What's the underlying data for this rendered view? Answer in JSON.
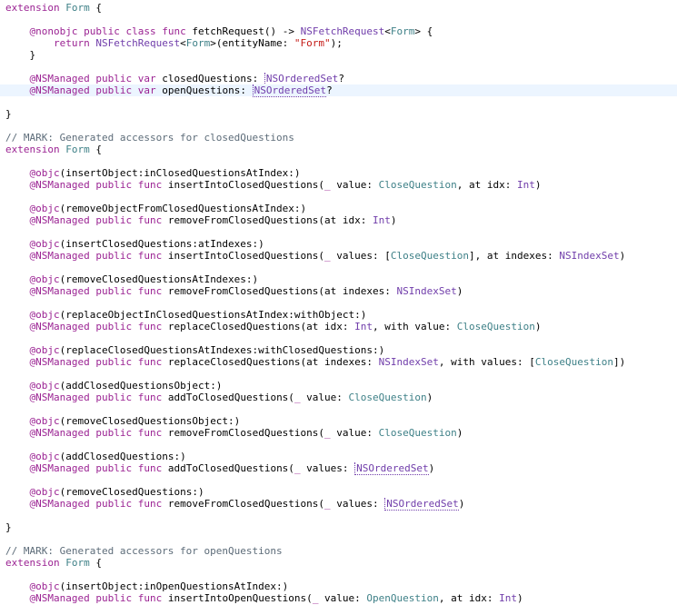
{
  "editor": {
    "colors": {
      "keyword": "#9b2393",
      "type": "#703daa",
      "project_type": "#3e8087",
      "string": "#c41a16",
      "comment": "#5d6c79",
      "current_line": "#ecf5ff"
    },
    "lines": [
      {
        "row": 0,
        "tokens": [
          {
            "t": "extension",
            "c": "kw"
          },
          {
            "t": " ",
            "c": "plain"
          },
          {
            "t": "Form",
            "c": "ref"
          },
          {
            "t": " {",
            "c": "plain"
          }
        ]
      },
      {
        "row": 2,
        "tokens": [
          {
            "t": "    ",
            "c": "plain"
          },
          {
            "t": "@nonobjc",
            "c": "kw"
          },
          {
            "t": " ",
            "c": "plain"
          },
          {
            "t": "public",
            "c": "kw"
          },
          {
            "t": " ",
            "c": "plain"
          },
          {
            "t": "class",
            "c": "kw"
          },
          {
            "t": " ",
            "c": "plain"
          },
          {
            "t": "func",
            "c": "kw"
          },
          {
            "t": " fetchRequest() -> ",
            "c": "plain"
          },
          {
            "t": "NSFetchRequest",
            "c": "tp"
          },
          {
            "t": "<",
            "c": "plain"
          },
          {
            "t": "Form",
            "c": "ref"
          },
          {
            "t": "> {",
            "c": "plain"
          }
        ]
      },
      {
        "row": 3,
        "tokens": [
          {
            "t": "        ",
            "c": "plain"
          },
          {
            "t": "return",
            "c": "kw"
          },
          {
            "t": " ",
            "c": "plain"
          },
          {
            "t": "NSFetchRequest",
            "c": "tp"
          },
          {
            "t": "<",
            "c": "plain"
          },
          {
            "t": "Form",
            "c": "ref"
          },
          {
            "t": ">(entityName: ",
            "c": "plain"
          },
          {
            "t": "\"Form\"",
            "c": "str"
          },
          {
            "t": ");",
            "c": "plain"
          }
        ]
      },
      {
        "row": 4,
        "tokens": [
          {
            "t": "    }",
            "c": "plain"
          }
        ]
      },
      {
        "row": 6,
        "tokens": [
          {
            "t": "    ",
            "c": "plain"
          },
          {
            "t": "@NSManaged",
            "c": "kw"
          },
          {
            "t": " ",
            "c": "plain"
          },
          {
            "t": "public",
            "c": "kw"
          },
          {
            "t": " ",
            "c": "plain"
          },
          {
            "t": "var",
            "c": "kw"
          },
          {
            "t": " closedQuestions: ",
            "c": "plain"
          },
          {
            "t": "NSOrderedSet",
            "c": "tp",
            "u": true
          },
          {
            "t": "?",
            "c": "plain"
          }
        ]
      },
      {
        "row": 7,
        "current": true,
        "tokens": [
          {
            "t": "    ",
            "c": "plain"
          },
          {
            "t": "@NSManaged",
            "c": "kw"
          },
          {
            "t": " ",
            "c": "plain"
          },
          {
            "t": "public",
            "c": "kw"
          },
          {
            "t": " ",
            "c": "plain"
          },
          {
            "t": "var",
            "c": "kw"
          },
          {
            "t": " openQuestions: ",
            "c": "plain"
          },
          {
            "t": "NSOrderedSet",
            "c": "tp",
            "u": true
          },
          {
            "t": "?",
            "c": "plain"
          }
        ]
      },
      {
        "row": 9,
        "tokens": [
          {
            "t": "}",
            "c": "plain"
          }
        ]
      },
      {
        "row": 11,
        "tokens": [
          {
            "t": "// MARK: Generated accessors for closedQuestions",
            "c": "cm"
          }
        ]
      },
      {
        "row": 12,
        "tokens": [
          {
            "t": "extension",
            "c": "kw"
          },
          {
            "t": " ",
            "c": "plain"
          },
          {
            "t": "Form",
            "c": "ref"
          },
          {
            "t": " {",
            "c": "plain"
          }
        ]
      },
      {
        "row": 14,
        "tokens": [
          {
            "t": "    ",
            "c": "plain"
          },
          {
            "t": "@objc",
            "c": "kw"
          },
          {
            "t": "(insertObject:inClosedQuestionsAtIndex:)",
            "c": "plain"
          }
        ]
      },
      {
        "row": 15,
        "tokens": [
          {
            "t": "    ",
            "c": "plain"
          },
          {
            "t": "@NSManaged",
            "c": "kw"
          },
          {
            "t": " ",
            "c": "plain"
          },
          {
            "t": "public",
            "c": "kw"
          },
          {
            "t": " ",
            "c": "plain"
          },
          {
            "t": "func",
            "c": "kw"
          },
          {
            "t": " insertIntoClosedQuestions(",
            "c": "plain"
          },
          {
            "t": "_",
            "c": "kw"
          },
          {
            "t": " value: ",
            "c": "plain"
          },
          {
            "t": "CloseQuestion",
            "c": "ref"
          },
          {
            "t": ", at idx: ",
            "c": "plain"
          },
          {
            "t": "Int",
            "c": "tp"
          },
          {
            "t": ")",
            "c": "plain"
          }
        ]
      },
      {
        "row": 17,
        "tokens": [
          {
            "t": "    ",
            "c": "plain"
          },
          {
            "t": "@objc",
            "c": "kw"
          },
          {
            "t": "(removeObjectFromClosedQuestionsAtIndex:)",
            "c": "plain"
          }
        ]
      },
      {
        "row": 18,
        "tokens": [
          {
            "t": "    ",
            "c": "plain"
          },
          {
            "t": "@NSManaged",
            "c": "kw"
          },
          {
            "t": " ",
            "c": "plain"
          },
          {
            "t": "public",
            "c": "kw"
          },
          {
            "t": " ",
            "c": "plain"
          },
          {
            "t": "func",
            "c": "kw"
          },
          {
            "t": " removeFromClosedQuestions(at idx: ",
            "c": "plain"
          },
          {
            "t": "Int",
            "c": "tp"
          },
          {
            "t": ")",
            "c": "plain"
          }
        ]
      },
      {
        "row": 20,
        "tokens": [
          {
            "t": "    ",
            "c": "plain"
          },
          {
            "t": "@objc",
            "c": "kw"
          },
          {
            "t": "(insertClosedQuestions:atIndexes:)",
            "c": "plain"
          }
        ]
      },
      {
        "row": 21,
        "tokens": [
          {
            "t": "    ",
            "c": "plain"
          },
          {
            "t": "@NSManaged",
            "c": "kw"
          },
          {
            "t": " ",
            "c": "plain"
          },
          {
            "t": "public",
            "c": "kw"
          },
          {
            "t": " ",
            "c": "plain"
          },
          {
            "t": "func",
            "c": "kw"
          },
          {
            "t": " insertIntoClosedQuestions(",
            "c": "plain"
          },
          {
            "t": "_",
            "c": "kw"
          },
          {
            "t": " values: [",
            "c": "plain"
          },
          {
            "t": "CloseQuestion",
            "c": "ref"
          },
          {
            "t": "], at indexes: ",
            "c": "plain"
          },
          {
            "t": "NSIndexSet",
            "c": "tp"
          },
          {
            "t": ")",
            "c": "plain"
          }
        ]
      },
      {
        "row": 23,
        "tokens": [
          {
            "t": "    ",
            "c": "plain"
          },
          {
            "t": "@objc",
            "c": "kw"
          },
          {
            "t": "(removeClosedQuestionsAtIndexes:)",
            "c": "plain"
          }
        ]
      },
      {
        "row": 24,
        "tokens": [
          {
            "t": "    ",
            "c": "plain"
          },
          {
            "t": "@NSManaged",
            "c": "kw"
          },
          {
            "t": " ",
            "c": "plain"
          },
          {
            "t": "public",
            "c": "kw"
          },
          {
            "t": " ",
            "c": "plain"
          },
          {
            "t": "func",
            "c": "kw"
          },
          {
            "t": " removeFromClosedQuestions(at indexes: ",
            "c": "plain"
          },
          {
            "t": "NSIndexSet",
            "c": "tp"
          },
          {
            "t": ")",
            "c": "plain"
          }
        ]
      },
      {
        "row": 26,
        "tokens": [
          {
            "t": "    ",
            "c": "plain"
          },
          {
            "t": "@objc",
            "c": "kw"
          },
          {
            "t": "(replaceObjectInClosedQuestionsAtIndex:withObject:)",
            "c": "plain"
          }
        ]
      },
      {
        "row": 27,
        "tokens": [
          {
            "t": "    ",
            "c": "plain"
          },
          {
            "t": "@NSManaged",
            "c": "kw"
          },
          {
            "t": " ",
            "c": "plain"
          },
          {
            "t": "public",
            "c": "kw"
          },
          {
            "t": " ",
            "c": "plain"
          },
          {
            "t": "func",
            "c": "kw"
          },
          {
            "t": " replaceClosedQuestions(at idx: ",
            "c": "plain"
          },
          {
            "t": "Int",
            "c": "tp"
          },
          {
            "t": ", with value: ",
            "c": "plain"
          },
          {
            "t": "CloseQuestion",
            "c": "ref"
          },
          {
            "t": ")",
            "c": "plain"
          }
        ]
      },
      {
        "row": 29,
        "tokens": [
          {
            "t": "    ",
            "c": "plain"
          },
          {
            "t": "@objc",
            "c": "kw"
          },
          {
            "t": "(replaceClosedQuestionsAtIndexes:withClosedQuestions:)",
            "c": "plain"
          }
        ]
      },
      {
        "row": 30,
        "tokens": [
          {
            "t": "    ",
            "c": "plain"
          },
          {
            "t": "@NSManaged",
            "c": "kw"
          },
          {
            "t": " ",
            "c": "plain"
          },
          {
            "t": "public",
            "c": "kw"
          },
          {
            "t": " ",
            "c": "plain"
          },
          {
            "t": "func",
            "c": "kw"
          },
          {
            "t": " replaceClosedQuestions(at indexes: ",
            "c": "plain"
          },
          {
            "t": "NSIndexSet",
            "c": "tp"
          },
          {
            "t": ", with values: [",
            "c": "plain"
          },
          {
            "t": "CloseQuestion",
            "c": "ref"
          },
          {
            "t": "])",
            "c": "plain"
          }
        ]
      },
      {
        "row": 32,
        "tokens": [
          {
            "t": "    ",
            "c": "plain"
          },
          {
            "t": "@objc",
            "c": "kw"
          },
          {
            "t": "(addClosedQuestionsObject:)",
            "c": "plain"
          }
        ]
      },
      {
        "row": 33,
        "tokens": [
          {
            "t": "    ",
            "c": "plain"
          },
          {
            "t": "@NSManaged",
            "c": "kw"
          },
          {
            "t": " ",
            "c": "plain"
          },
          {
            "t": "public",
            "c": "kw"
          },
          {
            "t": " ",
            "c": "plain"
          },
          {
            "t": "func",
            "c": "kw"
          },
          {
            "t": " addToClosedQuestions(",
            "c": "plain"
          },
          {
            "t": "_",
            "c": "kw"
          },
          {
            "t": " value: ",
            "c": "plain"
          },
          {
            "t": "CloseQuestion",
            "c": "ref"
          },
          {
            "t": ")",
            "c": "plain"
          }
        ]
      },
      {
        "row": 35,
        "tokens": [
          {
            "t": "    ",
            "c": "plain"
          },
          {
            "t": "@objc",
            "c": "kw"
          },
          {
            "t": "(removeClosedQuestionsObject:)",
            "c": "plain"
          }
        ]
      },
      {
        "row": 36,
        "tokens": [
          {
            "t": "    ",
            "c": "plain"
          },
          {
            "t": "@NSManaged",
            "c": "kw"
          },
          {
            "t": " ",
            "c": "plain"
          },
          {
            "t": "public",
            "c": "kw"
          },
          {
            "t": " ",
            "c": "plain"
          },
          {
            "t": "func",
            "c": "kw"
          },
          {
            "t": " removeFromClosedQuestions(",
            "c": "plain"
          },
          {
            "t": "_",
            "c": "kw"
          },
          {
            "t": " value: ",
            "c": "plain"
          },
          {
            "t": "CloseQuestion",
            "c": "ref"
          },
          {
            "t": ")",
            "c": "plain"
          }
        ]
      },
      {
        "row": 38,
        "tokens": [
          {
            "t": "    ",
            "c": "plain"
          },
          {
            "t": "@objc",
            "c": "kw"
          },
          {
            "t": "(addClosedQuestions:)",
            "c": "plain"
          }
        ]
      },
      {
        "row": 39,
        "tokens": [
          {
            "t": "    ",
            "c": "plain"
          },
          {
            "t": "@NSManaged",
            "c": "kw"
          },
          {
            "t": " ",
            "c": "plain"
          },
          {
            "t": "public",
            "c": "kw"
          },
          {
            "t": " ",
            "c": "plain"
          },
          {
            "t": "func",
            "c": "kw"
          },
          {
            "t": " addToClosedQuestions(",
            "c": "plain"
          },
          {
            "t": "_",
            "c": "kw"
          },
          {
            "t": " values: ",
            "c": "plain"
          },
          {
            "t": "NSOrderedSet",
            "c": "tp",
            "u": true
          },
          {
            "t": ")",
            "c": "plain"
          }
        ]
      },
      {
        "row": 41,
        "tokens": [
          {
            "t": "    ",
            "c": "plain"
          },
          {
            "t": "@objc",
            "c": "kw"
          },
          {
            "t": "(removeClosedQuestions:)",
            "c": "plain"
          }
        ]
      },
      {
        "row": 42,
        "tokens": [
          {
            "t": "    ",
            "c": "plain"
          },
          {
            "t": "@NSManaged",
            "c": "kw"
          },
          {
            "t": " ",
            "c": "plain"
          },
          {
            "t": "public",
            "c": "kw"
          },
          {
            "t": " ",
            "c": "plain"
          },
          {
            "t": "func",
            "c": "kw"
          },
          {
            "t": " removeFromClosedQuestions(",
            "c": "plain"
          },
          {
            "t": "_",
            "c": "kw"
          },
          {
            "t": " values: ",
            "c": "plain"
          },
          {
            "t": "NSOrderedSet",
            "c": "tp",
            "u": true
          },
          {
            "t": ")",
            "c": "plain"
          }
        ]
      },
      {
        "row": 44,
        "tokens": [
          {
            "t": "}",
            "c": "plain"
          }
        ]
      },
      {
        "row": 46,
        "tokens": [
          {
            "t": "// MARK: Generated accessors for openQuestions",
            "c": "cm"
          }
        ]
      },
      {
        "row": 47,
        "tokens": [
          {
            "t": "extension",
            "c": "kw"
          },
          {
            "t": " ",
            "c": "plain"
          },
          {
            "t": "Form",
            "c": "ref"
          },
          {
            "t": " {",
            "c": "plain"
          }
        ]
      },
      {
        "row": 49,
        "tokens": [
          {
            "t": "    ",
            "c": "plain"
          },
          {
            "t": "@objc",
            "c": "kw"
          },
          {
            "t": "(insertObject:inOpenQuestionsAtIndex:)",
            "c": "plain"
          }
        ]
      },
      {
        "row": 50,
        "tokens": [
          {
            "t": "    ",
            "c": "plain"
          },
          {
            "t": "@NSManaged",
            "c": "kw"
          },
          {
            "t": " ",
            "c": "plain"
          },
          {
            "t": "public",
            "c": "kw"
          },
          {
            "t": " ",
            "c": "plain"
          },
          {
            "t": "func",
            "c": "kw"
          },
          {
            "t": " insertIntoOpenQuestions(",
            "c": "plain"
          },
          {
            "t": "_",
            "c": "kw"
          },
          {
            "t": " value: ",
            "c": "plain"
          },
          {
            "t": "OpenQuestion",
            "c": "ref"
          },
          {
            "t": ", at idx: ",
            "c": "plain"
          },
          {
            "t": "Int",
            "c": "tp"
          },
          {
            "t": ")",
            "c": "plain"
          }
        ]
      }
    ]
  }
}
